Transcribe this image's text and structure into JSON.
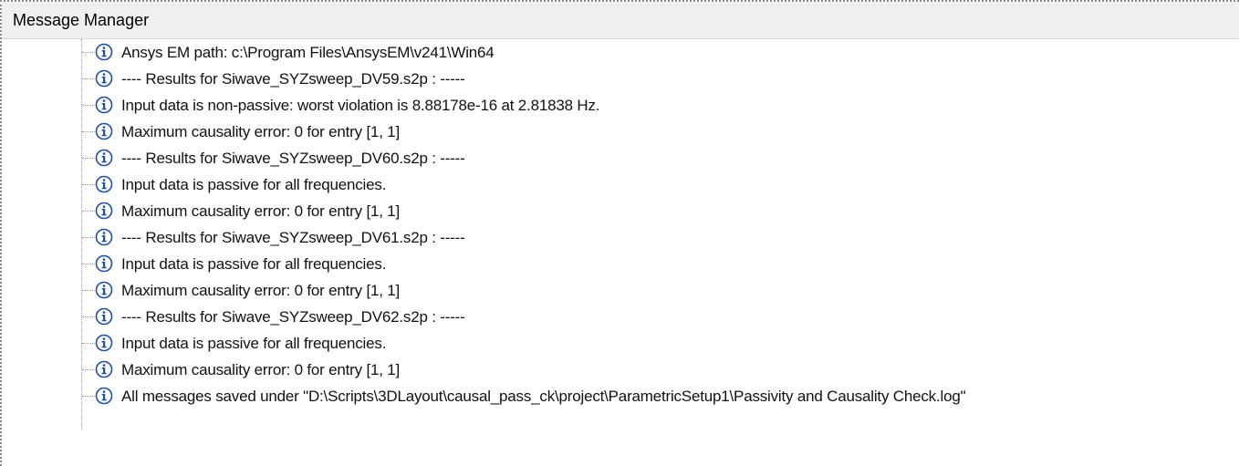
{
  "panel": {
    "title": "Message Manager"
  },
  "messages": [
    {
      "icon": "info-icon",
      "text": "Ansys EM path: c:\\Program Files\\AnsysEM\\v241\\Win64"
    },
    {
      "icon": "info-icon",
      "text": " ---- Results for Siwave_SYZsweep_DV59.s2p : -----"
    },
    {
      "icon": "info-icon",
      "text": "Input data is non-passive: worst violation is 8.88178e-16 at 2.81838 Hz."
    },
    {
      "icon": "info-icon",
      "text": "Maximum causality error: 0 for entry [1, 1]"
    },
    {
      "icon": "info-icon",
      "text": " ---- Results for Siwave_SYZsweep_DV60.s2p : -----"
    },
    {
      "icon": "info-icon",
      "text": "Input data is passive for all frequencies."
    },
    {
      "icon": "info-icon",
      "text": "Maximum causality error: 0 for entry [1, 1]"
    },
    {
      "icon": "info-icon",
      "text": " ---- Results for Siwave_SYZsweep_DV61.s2p : -----"
    },
    {
      "icon": "info-icon",
      "text": "Input data is passive for all frequencies."
    },
    {
      "icon": "info-icon",
      "text": "Maximum causality error: 0 for entry [1, 1]"
    },
    {
      "icon": "info-icon",
      "text": " ---- Results for Siwave_SYZsweep_DV62.s2p : -----"
    },
    {
      "icon": "info-icon",
      "text": "Input data is passive for all frequencies."
    },
    {
      "icon": "info-icon",
      "text": "Maximum causality error: 0 for entry [1, 1]"
    },
    {
      "icon": "info-icon",
      "text": "All messages saved under \"D:\\Scripts\\3DLayout\\causal_pass_ck\\project\\ParametricSetup1\\Passivity and Causality Check.log\""
    }
  ],
  "colors": {
    "info_icon": "#1e4fa6",
    "titlebar_bg": "#f0f0f0"
  }
}
